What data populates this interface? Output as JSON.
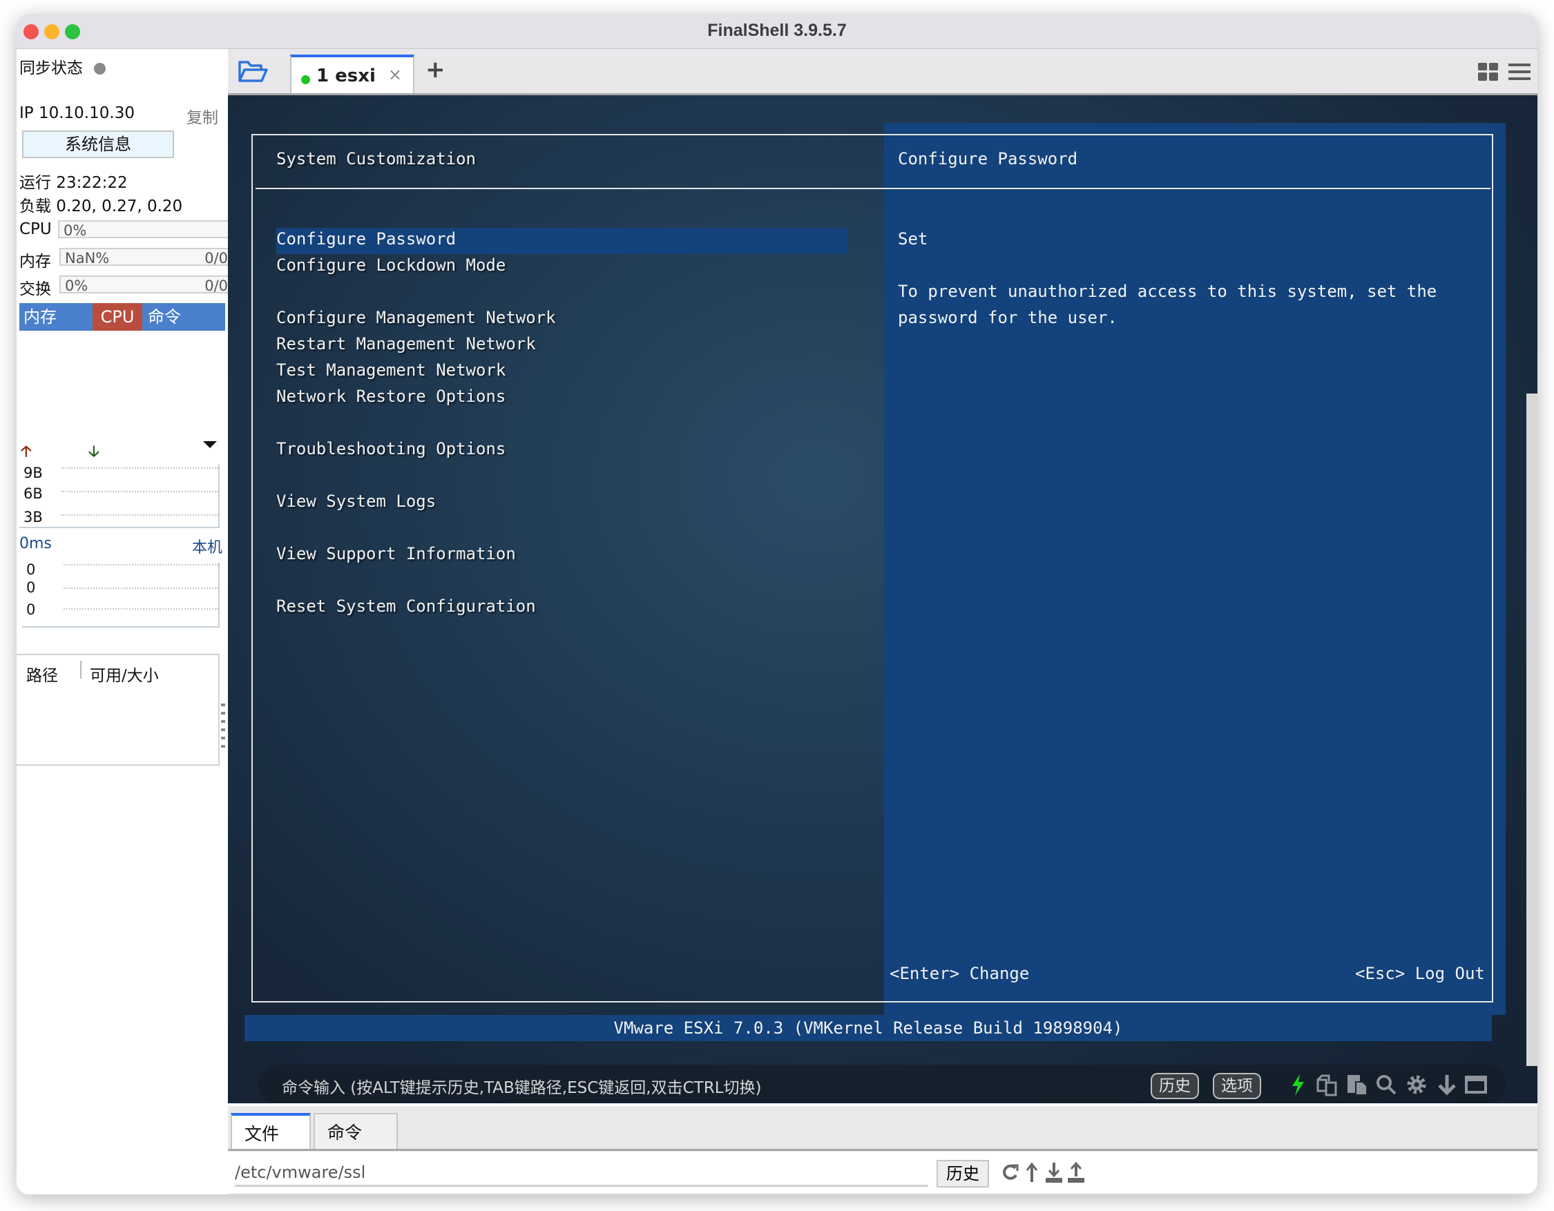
{
  "window": {
    "title": "FinalShell 3.9.5.7"
  },
  "sidebar": {
    "sync_status_label": "同步状态",
    "ip_label": "IP 10.10.10.30",
    "copy_label": "复制",
    "sysinfo_button": "系统信息",
    "uptime": "运行 23:22:22",
    "load": "负载 0.20, 0.27, 0.20",
    "meters": [
      {
        "label": "CPU",
        "value": "0%",
        "detail": ""
      },
      {
        "label": "内存",
        "value": "NaN%",
        "detail": "0/0"
      },
      {
        "label": "交换",
        "value": "0%",
        "detail": "0/0"
      }
    ],
    "process_tabs": [
      {
        "label": "内存",
        "color": "#4a80cc"
      },
      {
        "label": "CPU",
        "color": "#b94e3e"
      },
      {
        "label": "命令",
        "color": "#4a80cc"
      }
    ],
    "network": {
      "upload_icon": "arrow-up-icon",
      "download_icon": "arrow-down-icon",
      "y_labels": [
        "9B",
        "6B",
        "3B"
      ]
    },
    "ping": {
      "latency": "0ms",
      "target": "本机",
      "y_labels": [
        "0",
        "0",
        "0"
      ]
    },
    "disk_table": {
      "headers": [
        "路径",
        "可用/大小"
      ]
    }
  },
  "tabs": {
    "items": [
      {
        "label": "1 esxi",
        "status_color": "#1fc51f",
        "active": true
      }
    ],
    "close_glyph": "×",
    "add_glyph": "+"
  },
  "terminal": {
    "left_title": "System Customization",
    "right_title": "Configure Password",
    "menu_items": [
      {
        "label": "Configure Password",
        "selected": true
      },
      {
        "label": "Configure Lockdown Mode",
        "selected": false
      },
      {
        "label": "Configure Management Network",
        "selected": false
      },
      {
        "label": "Restart Management Network",
        "selected": false
      },
      {
        "label": "Test Management Network",
        "selected": false
      },
      {
        "label": "Network Restore Options",
        "selected": false
      },
      {
        "label": "Troubleshooting Options",
        "selected": false
      },
      {
        "label": "View System Logs",
        "selected": false
      },
      {
        "label": "View Support Information",
        "selected": false
      },
      {
        "label": "Reset System Configuration",
        "selected": false
      }
    ],
    "detail_status": "Set",
    "detail_text_line1": "To prevent unauthorized access to this system, set the",
    "detail_text_line2": "password for the user.",
    "hint_enter": "<Enter> Change",
    "hint_esc": "<Esc> Log Out",
    "footer": "VMware ESXi 7.0.3 (VMKernel Release Build 19898904)",
    "panel_color": "#13427c"
  },
  "command_bar": {
    "placeholder": "命令输入 (按ALT键提示历史,TAB键路径,ESC键返回,双击CTRL切换)",
    "history_button": "历史",
    "options_button": "选项",
    "icons": [
      "lightning-icon",
      "copy-icon",
      "paste-icon",
      "search-icon",
      "gear-icon",
      "download-icon",
      "maximize-icon"
    ]
  },
  "bottom_panel": {
    "tabs": [
      {
        "label": "文件",
        "active": true
      },
      {
        "label": "命令",
        "active": false
      }
    ],
    "path": "/etc/vmware/ssl",
    "history_button": "历史",
    "icons": [
      "refresh-icon",
      "up-dir-icon",
      "download-icon",
      "upload-icon"
    ]
  }
}
